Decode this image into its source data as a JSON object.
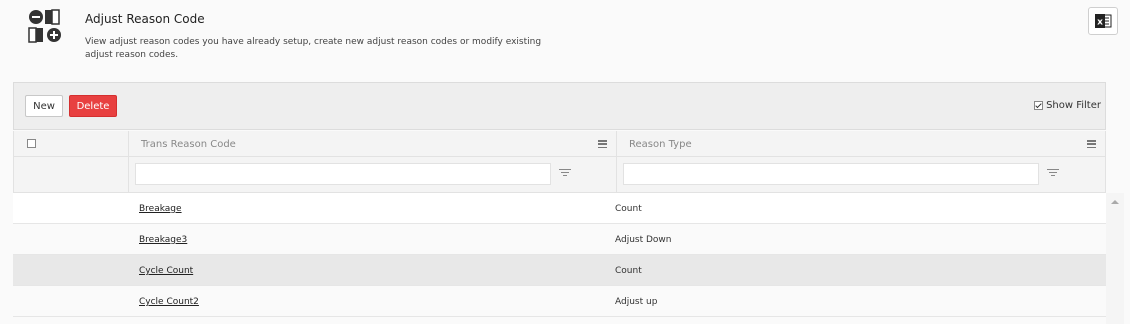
{
  "header": {
    "title": "Adjust Reason Code",
    "description": "View adjust reason codes you have already setup, create new adjust reason codes or modify existing adjust reason codes.",
    "app_icon": "reason-code-icon",
    "export_icon": "excel-export-icon"
  },
  "toolbar": {
    "new_label": "New",
    "delete_label": "Delete",
    "show_filter_label": "Show Filter",
    "show_filter_checked": true
  },
  "grid": {
    "columns": [
      {
        "label": "Trans Reason Code"
      },
      {
        "label": "Reason Type"
      }
    ],
    "filters": [
      "",
      ""
    ],
    "rows": [
      {
        "code": "Breakage",
        "type": "Count",
        "selected": false
      },
      {
        "code": "Breakage3",
        "type": "Adjust Down",
        "selected": false
      },
      {
        "code": "Cycle Count",
        "type": "Count",
        "selected": true
      },
      {
        "code": "Cycle Count2",
        "type": "Adjust up",
        "selected": false
      }
    ]
  },
  "colors": {
    "delete_bg": "#e84040",
    "selected_row": "#e8e8e8",
    "excel_green": "#1d1d1d"
  }
}
